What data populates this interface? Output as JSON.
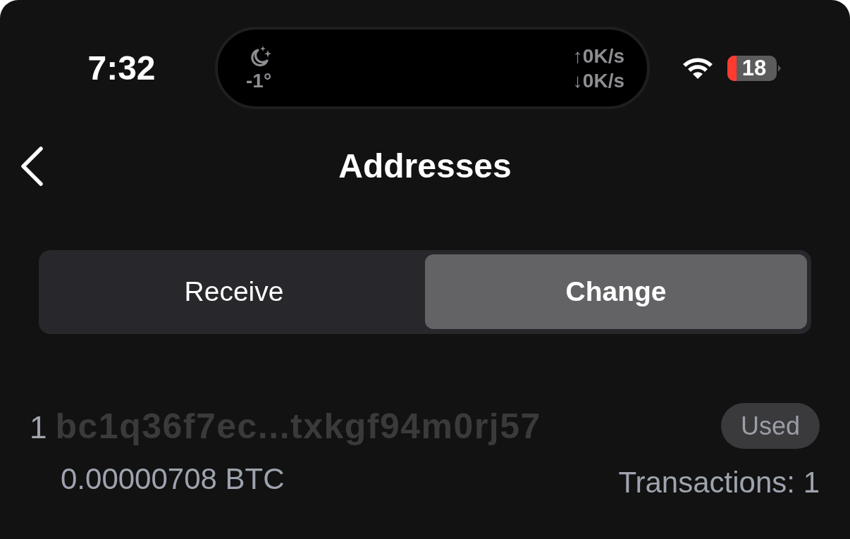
{
  "status_bar": {
    "time": "7:32",
    "island": {
      "temperature": "-1°",
      "upload": "↑0K/s",
      "download": "↓0K/s"
    },
    "battery": "18"
  },
  "nav": {
    "title": "Addresses"
  },
  "tabs": [
    {
      "label": "Receive",
      "selected": false
    },
    {
      "label": "Change",
      "selected": true
    }
  ],
  "addresses": [
    {
      "index": "1",
      "address": "bc1q36f7ec...txkgf94m0rj57",
      "status": "Used",
      "balance": "0.00000708 BTC",
      "transactions": "Transactions: 1"
    }
  ]
}
